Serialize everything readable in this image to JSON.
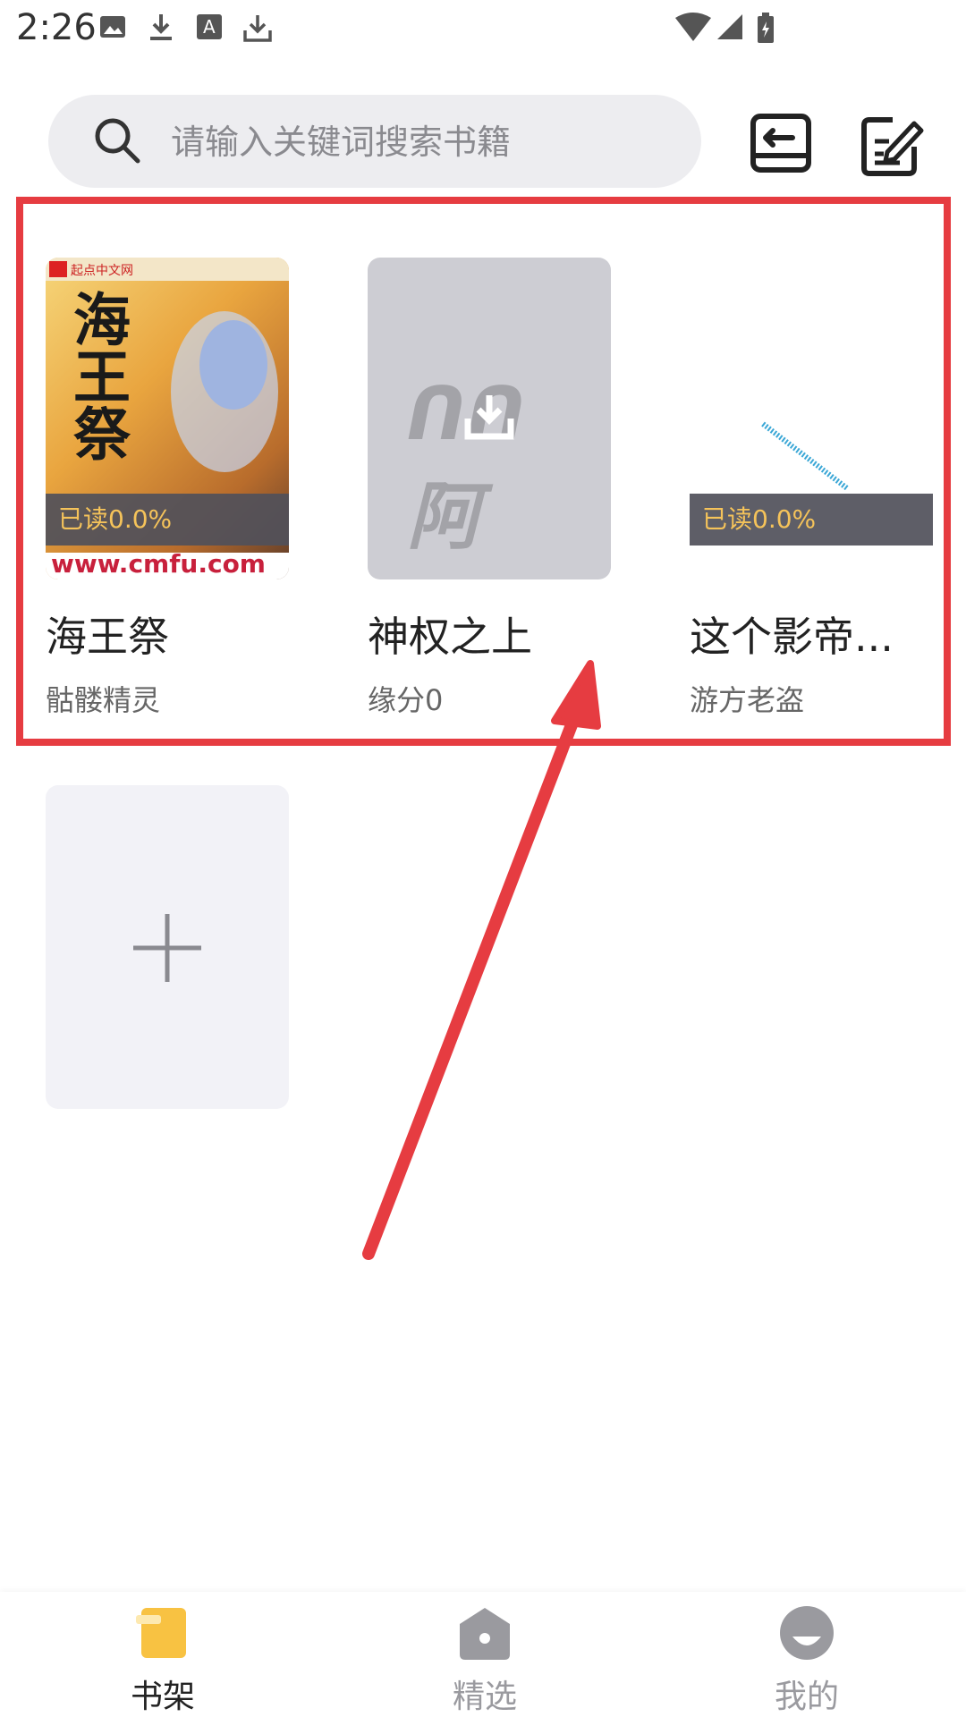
{
  "status_bar": {
    "time": "2:26"
  },
  "search": {
    "placeholder": "请输入关键词搜索书籍"
  },
  "books": [
    {
      "title": "海王祭",
      "author": "骷髅精灵",
      "progress": "已读0.0%",
      "cover_text": "海王祭",
      "cover_url_text": "www.cmfu.com",
      "cover_badge": "起点中文网"
    },
    {
      "title": "神权之上",
      "author": "缘分0",
      "cover_logo": "ᑎᑎ 阿"
    },
    {
      "title": "这个影帝...",
      "author": "游方老盗",
      "progress": "已读0.0%"
    }
  ],
  "nav": [
    {
      "label": "书架",
      "icon": "bookshelf-icon",
      "active": true
    },
    {
      "label": "精选",
      "icon": "home-icon",
      "active": false
    },
    {
      "label": "我的",
      "icon": "profile-icon",
      "active": false
    }
  ],
  "colors": {
    "accent": "#f8c242",
    "highlight": "#e63c41",
    "inactive": "#9a9a9f"
  }
}
